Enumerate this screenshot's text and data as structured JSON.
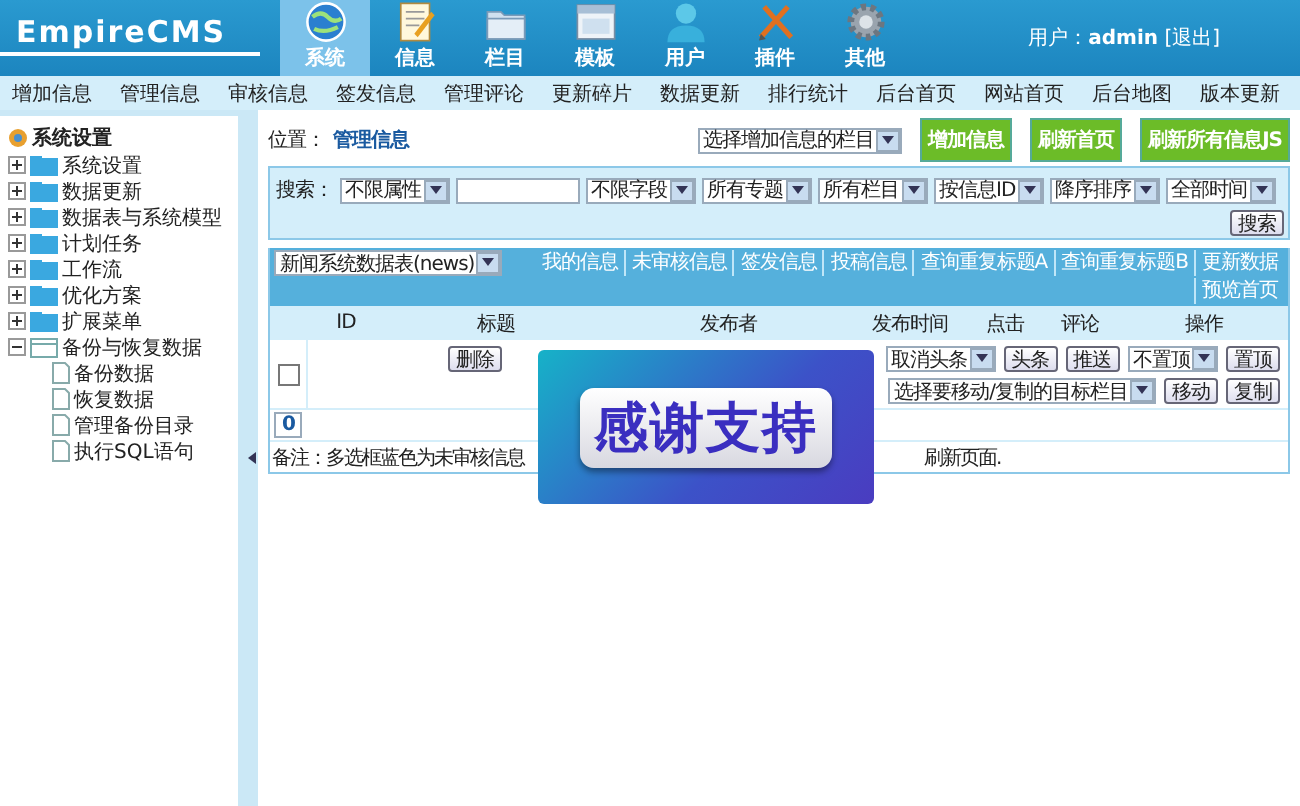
{
  "header": {
    "logo": "EmpireCMS",
    "nav": [
      {
        "label": "系统",
        "selected": true
      },
      {
        "label": "信息",
        "selected": false
      },
      {
        "label": "栏目",
        "selected": false
      },
      {
        "label": "模板",
        "selected": false
      },
      {
        "label": "用户",
        "selected": false
      },
      {
        "label": "插件",
        "selected": false
      },
      {
        "label": "其他",
        "selected": false
      }
    ],
    "user_label": "用户：",
    "user_name": "admin",
    "logout": "[退出]"
  },
  "menu": [
    "增加信息",
    "管理信息",
    "审核信息",
    "签发信息",
    "管理评论",
    "更新碎片",
    "数据更新",
    "排行统计",
    "后台首页",
    "网站首页",
    "后台地图",
    "版本更新"
  ],
  "sidebar": {
    "title": "系统设置",
    "items": [
      {
        "label": "系统设置",
        "expanded": false
      },
      {
        "label": "数据更新",
        "expanded": false
      },
      {
        "label": "数据表与系统模型",
        "expanded": false
      },
      {
        "label": "计划任务",
        "expanded": false
      },
      {
        "label": "工作流",
        "expanded": false
      },
      {
        "label": "优化方案",
        "expanded": false
      },
      {
        "label": "扩展菜单",
        "expanded": false
      },
      {
        "label": "备份与恢复数据",
        "expanded": true,
        "children": [
          {
            "label": "备份数据"
          },
          {
            "label": "恢复数据"
          },
          {
            "label": "管理备份目录"
          },
          {
            "label": "执行SQL语句"
          }
        ]
      }
    ]
  },
  "main": {
    "location_label": "位置：",
    "location": "管理信息",
    "column_select": "选择增加信息的栏目",
    "actions": [
      "增加信息",
      "刷新首页",
      "刷新所有信息JS"
    ],
    "search": {
      "label": "搜索：",
      "fields": [
        {
          "kind": "select",
          "value": "不限属性"
        },
        {
          "kind": "input"
        },
        {
          "kind": "select",
          "value": "不限字段"
        },
        {
          "kind": "select",
          "value": "所有专题"
        },
        {
          "kind": "select",
          "value": "所有栏目"
        },
        {
          "kind": "select",
          "value": "按信息ID"
        },
        {
          "kind": "select",
          "value": "降序排序"
        },
        {
          "kind": "select",
          "value": "全部时间"
        }
      ],
      "button": "搜索"
    },
    "table": {
      "table_select": "新闻系统数据表(news)",
      "links": [
        "我的信息",
        "未审核信息",
        "签发信息",
        "投稿信息",
        "查询重复标题A",
        "查询重复标题B",
        "更新数据",
        "预览首页"
      ],
      "columns": [
        "ID",
        "标题",
        "发布者",
        "发布时间",
        "点击",
        "评论",
        "操作"
      ],
      "row": {
        "checked": false,
        "actions_left": [
          {
            "kind": "button",
            "label": "删除"
          }
        ],
        "actions_right": [
          {
            "kind": "select",
            "label": "取消头条"
          },
          {
            "kind": "button",
            "label": "头条"
          },
          {
            "kind": "button",
            "label": "推送"
          },
          {
            "kind": "select",
            "label": "不置顶"
          },
          {
            "kind": "button",
            "label": "置顶"
          }
        ],
        "actions_line2": [
          {
            "kind": "select",
            "label": "选择要移动/复制的目标栏目"
          },
          {
            "kind": "button",
            "label": "移动"
          },
          {
            "kind": "button",
            "label": "复制"
          }
        ]
      },
      "count": "0",
      "note_left": "备注：多选框蓝色为未审核信息",
      "note_right": "刷新页面."
    }
  },
  "overlay": {
    "text": "感谢支持"
  }
}
